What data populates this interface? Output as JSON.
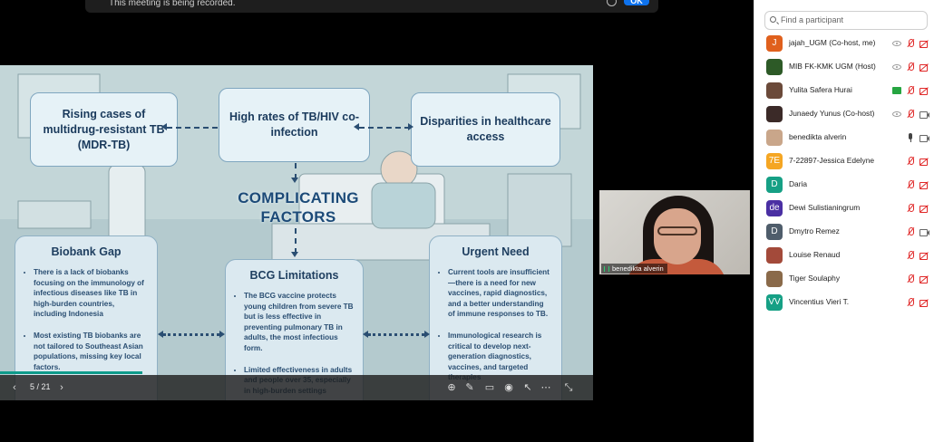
{
  "banner": {
    "text": "This meeting is being recorded.",
    "ok_label": "OK"
  },
  "slide": {
    "top_boxes": [
      "Rising cases of multidrug-resistant TB (MDR-TB)",
      "High rates of TB/HIV co-infection",
      "Disparities in healthcare access"
    ],
    "center_title": "COMPLICATING FACTORS",
    "panels": [
      {
        "title": "Biobank Gap",
        "bullets": [
          "There is a lack of biobanks focusing on the immunology of infectious diseases like TB in high-burden countries, including Indonesia",
          "Most existing TB biobanks are not tailored to Southeast Asian populations, missing key local factors."
        ]
      },
      {
        "title": "BCG Limitations",
        "bullets": [
          "The BCG vaccine protects young children from severe TB but is less effective in preventing pulmonary TB in adults, the most infectious form.",
          "Limited effectiveness in adults and people over 35, especially in high-burden settings"
        ]
      },
      {
        "title": "Urgent Need",
        "bullets": [
          "Current tools are insufficient—there is a need for new vaccines, rapid diagnostics, and a better understanding of immune responses to TB.",
          "Immunological research is critical to develop next-generation diagnostics, vaccines, and targeted therapies"
        ]
      }
    ]
  },
  "toolbar": {
    "page": "5 / 21",
    "progress": 0.24
  },
  "video": {
    "name": "benedikta alverin"
  },
  "participants_panel": {
    "search_placeholder": "Find a participant",
    "participants": [
      {
        "initials": "J",
        "color": "#e0601d",
        "name": "jajah_UGM (Co-host, me)",
        "share": "eye",
        "mic": "muted",
        "cam": "muted"
      },
      {
        "initials": "",
        "color": "#2d5a27",
        "name": "MIB FK-KMK UGM (Host)",
        "share": "eye",
        "mic": "muted",
        "cam": "muted"
      },
      {
        "initials": "",
        "color": "#6b4a3a",
        "name": "Yulita Safera Hurai",
        "share": "screen",
        "mic": "muted",
        "cam": "muted"
      },
      {
        "initials": "",
        "color": "#3b2a28",
        "name": "Junaedy Yunus (Co-host)",
        "share": "eye",
        "mic": "muted",
        "cam": "on"
      },
      {
        "initials": "",
        "color": "#c9a68a",
        "name": "benedikta alverin",
        "share": "",
        "mic": "on",
        "cam": "on"
      },
      {
        "initials": "7E",
        "color": "#f5a623",
        "name": "7-22897-Jessica Edelyne",
        "share": "",
        "mic": "muted",
        "cam": "muted"
      },
      {
        "initials": "D",
        "color": "#16a085",
        "name": "Daria",
        "share": "",
        "mic": "muted",
        "cam": "muted"
      },
      {
        "initials": "de",
        "color": "#4a2fa3",
        "name": "Dewi Sulistianingrum",
        "share": "",
        "mic": "muted",
        "cam": "muted"
      },
      {
        "initials": "D",
        "color": "#4f5d6b",
        "name": "Dmytro Remez",
        "share": "",
        "mic": "muted",
        "cam": "on"
      },
      {
        "initials": "",
        "color": "#a34a3a",
        "name": "Louise Renaud",
        "share": "",
        "mic": "muted",
        "cam": "muted"
      },
      {
        "initials": "",
        "color": "#8a6a4a",
        "name": "Tiger Soulaphy",
        "share": "",
        "mic": "muted",
        "cam": "muted"
      },
      {
        "initials": "VV",
        "color": "#16a085",
        "name": "Vincentius Vieri T.",
        "share": "",
        "mic": "muted",
        "cam": "muted"
      }
    ]
  }
}
